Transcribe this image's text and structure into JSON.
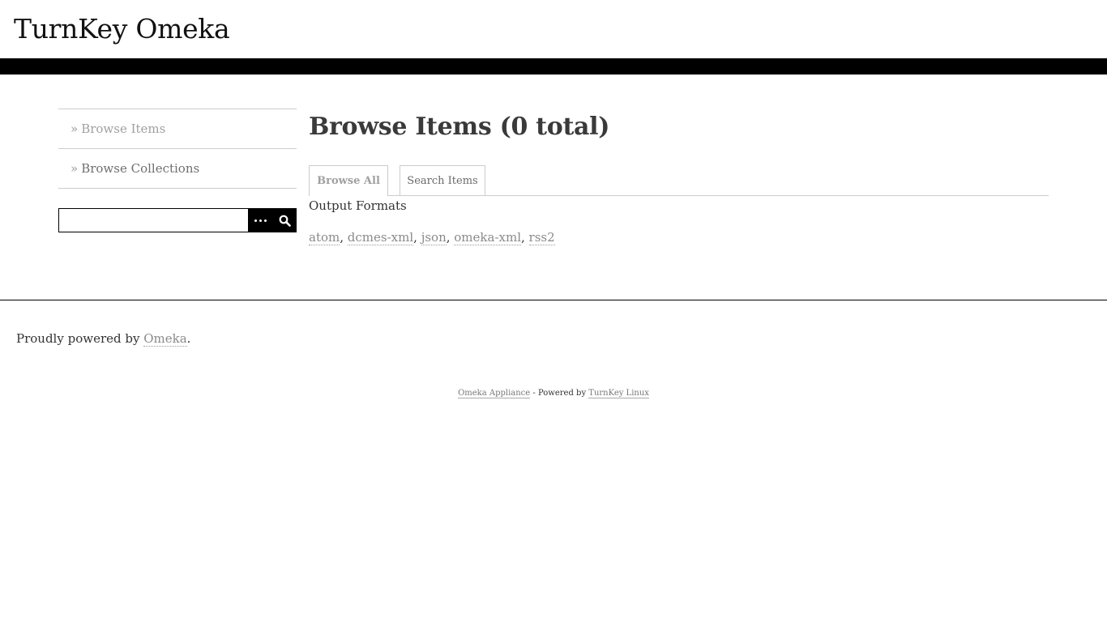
{
  "site": {
    "title": "TurnKey Omeka"
  },
  "sidebar": {
    "nav": [
      {
        "arrow": "»",
        "label": "Browse Items"
      },
      {
        "arrow": "»",
        "label": "Browse Collections"
      }
    ],
    "search": {
      "value": "",
      "advanced_icon": "ellipsis-icon",
      "submit_icon": "search-icon"
    }
  },
  "main": {
    "title": "Browse Items (0 total)",
    "tabs": [
      {
        "label": "Browse All"
      },
      {
        "label": "Search Items"
      }
    ],
    "output_formats": {
      "heading": "Output Formats",
      "links": [
        "atom",
        "dcmes-xml",
        "json",
        "omeka-xml",
        "rss2"
      ],
      "separator": ", "
    }
  },
  "footer": {
    "powered_prefix": "Proudly powered by ",
    "powered_link": "Omeka",
    "powered_suffix": ".",
    "credits_link1": "Omeka Appliance",
    "credits_middle": " - Powered by ",
    "credits_link2": "TurnKey Linux"
  },
  "colors": {
    "header_bar": "#000000",
    "link": "#8a8a8a",
    "active_nav": "#a0a0a0",
    "text": "#333333"
  }
}
